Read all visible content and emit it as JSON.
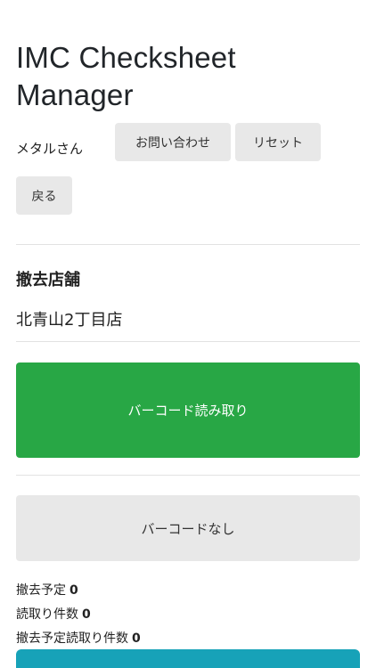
{
  "header": {
    "title": "IMC Checksheet Manager",
    "user_label": "メタルさん",
    "contact_button": "お問い合わせ",
    "reset_button": "リセット",
    "back_button": "戻る"
  },
  "store": {
    "heading": "撤去店舗",
    "name": "北青山2丁目店"
  },
  "actions": {
    "scan_barcode": "バーコード読み取り",
    "no_barcode": "バーコードなし"
  },
  "stats": [
    {
      "label": "撤去予定",
      "value": "0"
    },
    {
      "label": "読取り件数",
      "value": "0"
    },
    {
      "label": "撤去予定読取り件数",
      "value": "0"
    }
  ],
  "colors": {
    "scan_button": "#28a745",
    "secondary_button": "#e8e8e8",
    "bottom_button": "#17a2b8"
  }
}
